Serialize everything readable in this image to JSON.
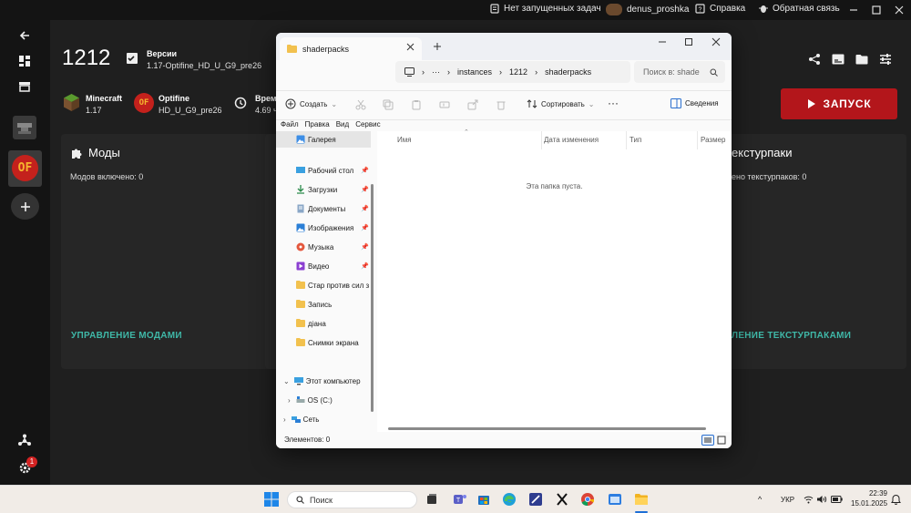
{
  "launcher": {
    "topbar": {
      "tasks": "Нет запущенных задач",
      "user": "denus_proshka",
      "help": "Справка",
      "feedback": "Обратная связь"
    },
    "instance": {
      "name": "1212",
      "version_label": "Версии",
      "version_value": "1.17-Optifine_HD_U_G9_pre26",
      "minecraft_label": "Minecraft",
      "minecraft_value": "1.17",
      "optifine_label": "Optifine",
      "optifine_value": "HD_U_G9_pre26",
      "time_label": "Врем",
      "time_value": "4.69 ч"
    },
    "launch_button": "ЗАПУСК",
    "mods": {
      "title": "Моды",
      "count": "Модов включено: 0",
      "manage": "УПРАВЛЕНИЕ МОДАМИ"
    },
    "texturepacks": {
      "title": "екстурпаки",
      "count": "ено текстурпаков: 0",
      "manage": "ЛЕНИЕ ТЕКСТУРПАКАМИ"
    },
    "notification_badge": "1",
    "colors": {
      "accent_red": "#b3161b",
      "teal": "#3fb8a8",
      "bg": "#1f1f1f"
    }
  },
  "explorer": {
    "tab_title": "shaderpacks",
    "breadcrumb": [
      "instances",
      "1212",
      "shaderpacks"
    ],
    "more": "···",
    "search_placeholder": "Поиск в: shade",
    "toolbar": {
      "create": "Создать",
      "sort": "Сортировать",
      "details": "Сведения",
      "more": "···"
    },
    "menu": [
      "Файл",
      "Правка",
      "Вид",
      "Сервис"
    ],
    "nav": {
      "gallery": "Галерея",
      "desktop": "Рабочий стол",
      "downloads": "Загрузки",
      "documents": "Документы",
      "pictures": "Изображения",
      "music": "Музыка",
      "video": "Видео",
      "folder1": "Стар против сил з",
      "folder2": "Запись",
      "folder3": "діана",
      "folder4": "Снимки экрана",
      "this_pc": "Этот компьютер",
      "os_drive": "OS (C:)",
      "network": "Сеть"
    },
    "columns": [
      "Имя",
      "Дата изменения",
      "Тип",
      "Размер"
    ],
    "empty_text": "Эта папка пуста.",
    "status": "Элементов: 0"
  },
  "taskbar": {
    "search": "Поиск",
    "language": "УКР",
    "time": "22:39",
    "date": "15.01.2025"
  }
}
